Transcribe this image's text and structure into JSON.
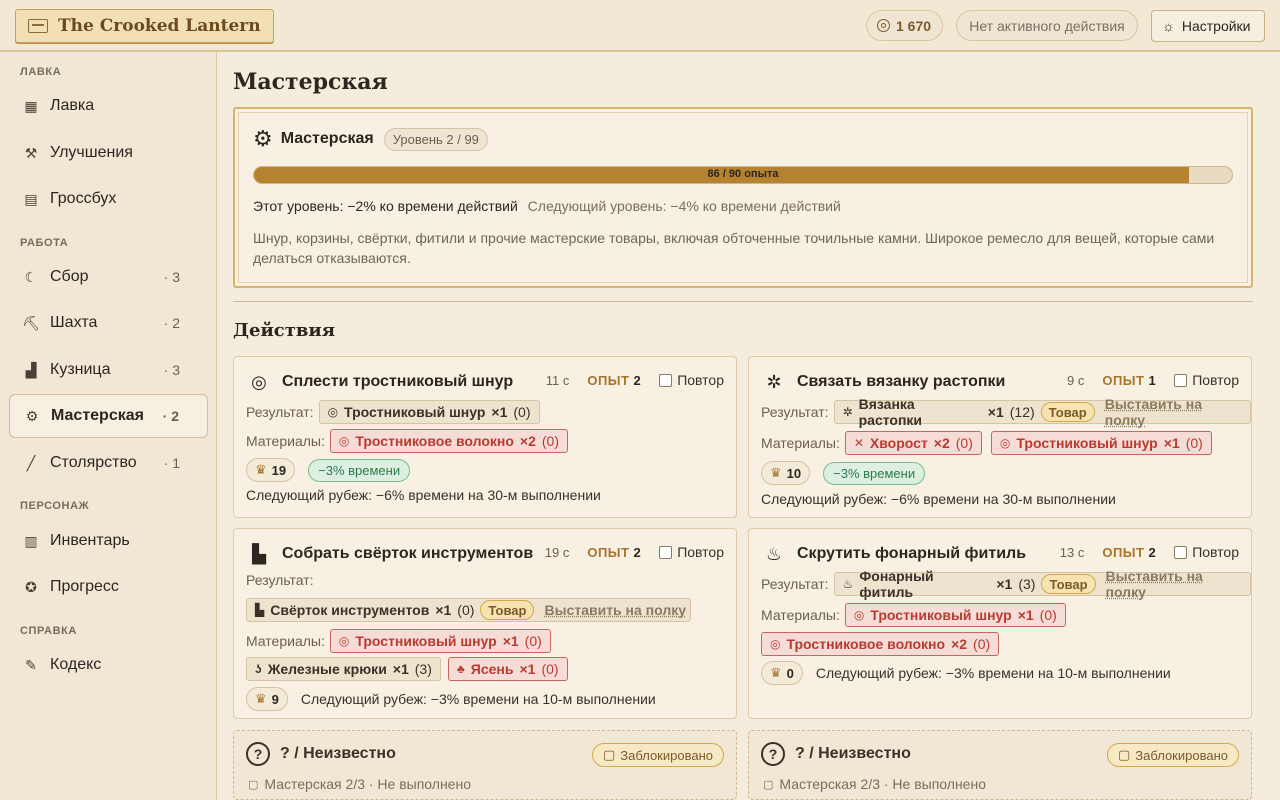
{
  "app": {
    "title": "The Crooked Lantern"
  },
  "header": {
    "coins": "1 670",
    "status": "Нет активного действия",
    "settings_label": "Настройки"
  },
  "sidebar": {
    "sections": [
      {
        "label": "ЛАВКА"
      },
      {
        "label": "РАБОТА"
      },
      {
        "label": "ПЕРСОНАЖ"
      },
      {
        "label": "СПРАВКА"
      }
    ],
    "items": [
      {
        "label": "Лавка",
        "count": ""
      },
      {
        "label": "Улучшения",
        "count": ""
      },
      {
        "label": "Гроссбух",
        "count": ""
      },
      {
        "label": "Сбор",
        "count": "· 3"
      },
      {
        "label": "Шахта",
        "count": "· 2"
      },
      {
        "label": "Кузница",
        "count": "· 3"
      },
      {
        "label": "Мастерская",
        "count": "· 2"
      },
      {
        "label": "Столярство",
        "count": "· 1"
      },
      {
        "label": "Инвентарь",
        "count": ""
      },
      {
        "label": "Прогресс",
        "count": ""
      },
      {
        "label": "Кодекс",
        "count": ""
      }
    ]
  },
  "page": {
    "title": "Мастерская",
    "skill": {
      "name": "Мастерская",
      "level": "Уровень 2 / 99",
      "xp_text": "86 / 90 опыта",
      "xp_fraction": 0.956,
      "this_level": "Этот уровень: −2% ко времени действий",
      "next_level": "Следующий уровень: −4% ко времени действий",
      "description": "Шнур, корзины, свёртки, фитили и прочие мастерские товары, включая обточенные точильные камни. Широкое ремесло для вещей, которые сами делаться отказываются."
    },
    "actions_title": "Действия",
    "labels": {
      "result": "Результат:",
      "materials": "Материалы:",
      "xp": "ОПЫТ",
      "repeat": "Повтор",
      "tovar": "Товар",
      "sell": "Выставить на полку"
    },
    "actions": [
      {
        "name": "Сплести тростниковый шнур",
        "time": "11 с",
        "xp": "2",
        "result": {
          "name": "Тростниковый шнур",
          "qty": "×1",
          "have": "(0)"
        },
        "materials": [
          {
            "name": "Тростниковое волокно",
            "qty": "×2",
            "have": "(0)"
          }
        ],
        "trophy": "19",
        "bonus": "−3% времени",
        "next": "Следующий рубеж: −6% времени на 30-м выполнении"
      },
      {
        "name": "Связать вязанку растопки",
        "time": "9 с",
        "xp": "1",
        "result": {
          "name": "Вязанка растопки",
          "qty": "×1",
          "have": "(12)"
        },
        "materials": [
          {
            "name": "Хворост",
            "qty": "×2",
            "have": "(0)"
          },
          {
            "name": "Тростниковый шнур",
            "qty": "×1",
            "have": "(0)"
          }
        ],
        "trophy": "10",
        "bonus": "−3% времени",
        "next": "Следующий рубеж: −6% времени на 30-м выполнении"
      },
      {
        "name": "Собрать свёрток инструментов",
        "time": "19 с",
        "xp": "2",
        "result": {
          "name": "Свёрток инструментов",
          "qty": "×1",
          "have": "(0)"
        },
        "materials": [
          {
            "name": "Тростниковый шнур",
            "qty": "×1",
            "have": "(0)"
          },
          {
            "name": "Железные крюки",
            "qty": "×1",
            "have": "(3)"
          },
          {
            "name": "Ясень",
            "qty": "×1",
            "have": "(0)"
          }
        ],
        "trophy": "9",
        "next": "Следующий рубеж: −3% времени на 10-м выполнении"
      },
      {
        "name": "Скрутить фонарный фитиль",
        "time": "13 с",
        "xp": "2",
        "result": {
          "name": "Фонарный фитиль",
          "qty": "×1",
          "have": "(3)"
        },
        "materials": [
          {
            "name": "Тростниковый шнур",
            "qty": "×1",
            "have": "(0)"
          },
          {
            "name": "Тростниковое волокно",
            "qty": "×2",
            "have": "(0)"
          }
        ],
        "trophy": "0",
        "next": "Следующий рубеж: −3% времени на 10-м выполнении"
      }
    ],
    "locked": [
      {
        "name": "? / Неизвестно",
        "badge": "Заблокировано",
        "req": "Мастерская 2/3 · Не выполнено"
      },
      {
        "name": "? / Неизвестно",
        "badge": "Заблокировано",
        "req": "Мастерская 2/3 · Не выполнено"
      }
    ]
  }
}
